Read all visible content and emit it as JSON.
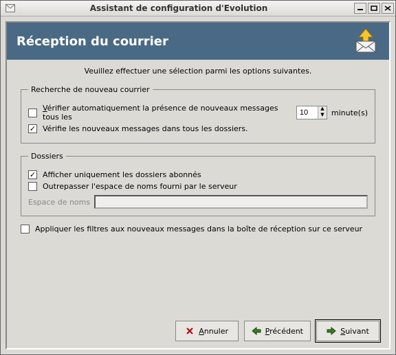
{
  "window": {
    "title": "Assistant de configuration d'Evolution"
  },
  "header": {
    "page_title": "Réception du courrier"
  },
  "instruction": "Veuillez effectuer une sélection parmi les options suivantes.",
  "group_search": {
    "legend": "Recherche de nouveau courrier",
    "auto_check_prefix": "V",
    "auto_check_rest": "érifier automatiquement la présence de nouveaux messages tous les",
    "auto_check_interval": "10",
    "auto_check_unit": "minute(s)",
    "auto_check_checked": false,
    "all_folders_label": "Vérifie les nouveaux messages dans tous les dossiers.",
    "all_folders_checked": true
  },
  "group_folders": {
    "legend": "Dossiers",
    "subscribed_label": "Afficher uniquement les dossiers abonnés",
    "subscribed_checked": true,
    "override_ns_label": "Outrepasser l'espace de noms fourni par le serveur",
    "override_ns_checked": false,
    "namespace_label": "Espace de noms",
    "namespace_value": ""
  },
  "apply_filters": {
    "label": "Appliquer les filtres aux nouveaux messages dans la boîte de réception sur ce serveur",
    "checked": false
  },
  "buttons": {
    "cancel_u": "A",
    "cancel_rest": "nnuler",
    "back_u": "P",
    "back_rest": "récédent",
    "next_u": "S",
    "next_rest": "uivant"
  }
}
